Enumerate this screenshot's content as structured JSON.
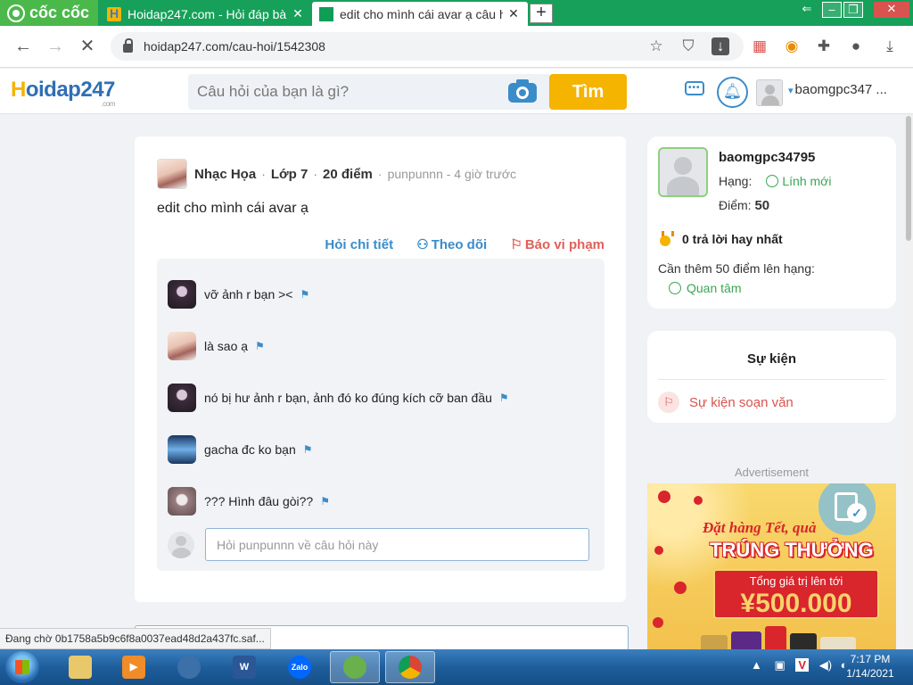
{
  "browser": {
    "brand": "cốc cốc",
    "tabs": [
      {
        "title": "Hoidap247.com - Hỏi đáp bài",
        "close": "✕"
      },
      {
        "title": "edit cho mình cái avar ạ câu h",
        "close": "✕"
      }
    ],
    "new_tab": "+",
    "url": "hoidap247.com/cau-hoi/1542308",
    "status_text": "Đang chờ 0b1758a5b9c6f8a0037ead48d2a437fc.saf..."
  },
  "site": {
    "logo_h": "H",
    "logo_rest": "oidap247",
    "logo_suffix": ".com",
    "search_placeholder": "Câu hỏi của bạn là gì?",
    "search_button": "Tìm",
    "username_short": "baomgpc347 ..."
  },
  "question": {
    "author": "Nhạc Họa",
    "grade": "Lớp 7",
    "points": "20 điểm",
    "meta": "punpunnn - 4 giờ trước",
    "text": "edit cho mình cái avar ạ",
    "actions": {
      "detail": "Hỏi chi tiết",
      "follow": "Theo dõi",
      "report": "Báo vi phạm"
    },
    "comments": [
      {
        "text": "vỡ ảnh r bạn ><",
        "avatar": "av-dark"
      },
      {
        "text": "là sao ạ",
        "avatar": "av-girl"
      },
      {
        "text": "nó bị hư ảnh r bạn, ảnh đó ko đúng kích cỡ ban đầu",
        "avatar": "av-dark"
      },
      {
        "text": "gacha đc ko bạn",
        "avatar": "av-blue"
      },
      {
        "text": "??? Hình đâu gòi??",
        "avatar": "av-grey"
      }
    ],
    "reply_placeholder": "Hỏi punpunnn về câu hỏi này"
  },
  "profile": {
    "username": "baomgpc34795",
    "rank_label": "Hạng:",
    "rank_value": "Lính mới",
    "points_label": "Điểm:",
    "points_value": "50",
    "best_answers": "0 trả lời hay nhất",
    "need_more": "Cần thêm 50 điểm lên hạng:",
    "follow": "Quan tâm"
  },
  "events": {
    "title": "Sự kiện",
    "item": "Sự kiện soạn văn"
  },
  "ad": {
    "label": "Advertisement",
    "line1": "Đặt hàng Tết, quà",
    "line2": "TRÚNG THƯỞNG",
    "line3": "Tổng giá trị lên tới",
    "line4": "¥500.000"
  },
  "taskbar": {
    "time": "7:17 PM",
    "date": "1/14/2021",
    "apps": [
      {
        "name": "explorer",
        "label": ""
      },
      {
        "name": "media",
        "label": ""
      },
      {
        "name": "media-center",
        "label": ""
      },
      {
        "name": "word",
        "label": "W"
      },
      {
        "name": "zalo",
        "label": "Zalo"
      },
      {
        "name": "coccoc",
        "label": ""
      },
      {
        "name": "chrome",
        "label": ""
      }
    ]
  },
  "colors": {
    "accent_blue": "#3a8cc9",
    "accent_yellow": "#f4b400",
    "report_red": "#e0605a",
    "rank_green": "#3aa655",
    "browser_green": "#16a05a"
  }
}
